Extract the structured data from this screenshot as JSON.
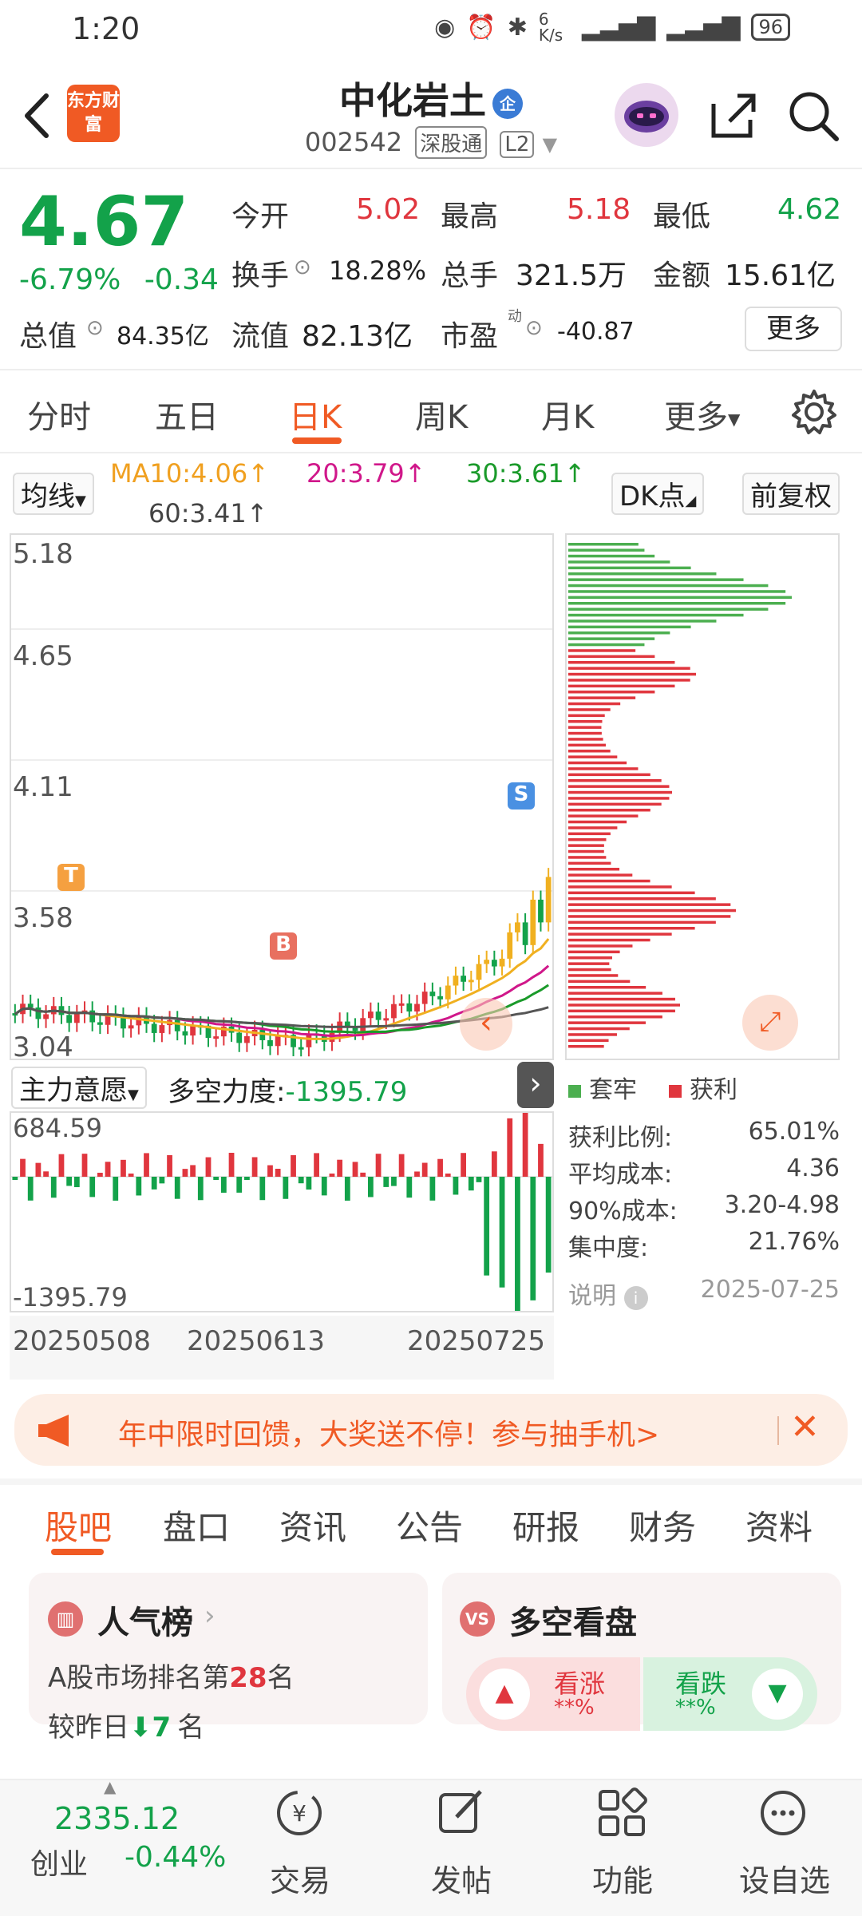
{
  "status_bar": {
    "time": "1:20",
    "speed": "6 K/s",
    "battery": "96"
  },
  "header": {
    "logo": "东方财富",
    "title": "中化岩土",
    "title_badge": "企",
    "code": "002542",
    "tags": [
      "深股通",
      "L2"
    ]
  },
  "quote": {
    "price": "4.67",
    "change_pct": "-6.79%",
    "change_amt": "-0.34",
    "open_label": "今开",
    "open": "5.02",
    "high_label": "最高",
    "high": "5.18",
    "low_label": "最低",
    "low": "4.62",
    "turnover_label": "换手",
    "turnover": "18.28%",
    "volume_label": "总手",
    "volume": "321.5万",
    "amount_label": "金额",
    "amount": "15.61亿",
    "mktcap_label": "总值",
    "mktcap": "84.35亿",
    "float_label": "流值",
    "float": "82.13亿",
    "pe_label": "市盈",
    "pe_sup": "动",
    "pe": "-40.87",
    "more_button": "更多"
  },
  "tabs": [
    "分时",
    "五日",
    "日K",
    "周K",
    "月K",
    "更多"
  ],
  "ma": {
    "selector": "均线",
    "ma10": "MA10:4.06↑",
    "ma20": "20:3.79↑",
    "ma30": "30:3.61↑",
    "ma60": "60:3.41↑",
    "dk_button": "DK点",
    "fq_button": "前复权"
  },
  "chart": {
    "y_labels": [
      "5.18",
      "4.65",
      "4.11",
      "3.58",
      "3.04"
    ],
    "marker_t": "T",
    "marker_b": "B",
    "marker_s": "S"
  },
  "indicator": {
    "selector": "主力意愿",
    "label": "多空力度:",
    "value": "-1395.79",
    "y_top": "684.59",
    "y_bottom": "-1395.79",
    "dates": [
      "20250508",
      "20250613",
      "20250725"
    ]
  },
  "chips": {
    "legend_trapped": "套牢",
    "legend_profit": "获利",
    "rows": [
      {
        "label": "获利比例:",
        "value": "65.01%"
      },
      {
        "label": "平均成本:",
        "value": "4.36"
      },
      {
        "label": "90%成本:",
        "value": "3.20-4.98"
      },
      {
        "label": "集中度:",
        "value": "21.76%"
      }
    ],
    "note_label": "说明",
    "date": "2025-07-25"
  },
  "banner": {
    "text": "年中限时回馈，大奖送不停！参与抽手机>"
  },
  "bottom_tabs": [
    "股吧",
    "盘口",
    "资讯",
    "公告",
    "研报",
    "财务",
    "资料"
  ],
  "popularity": {
    "title": "人气榜",
    "line1_prefix": "A股市场排名第",
    "rank": "28",
    "line1_suffix": "名",
    "line2_prefix": "较昨日",
    "change": "7",
    "line2_suffix": "名"
  },
  "sentiment": {
    "title": "多空看盘",
    "up_label": "看涨",
    "up_value": "**%",
    "down_label": "看跌",
    "down_value": "**%"
  },
  "footer": {
    "index_value": "2335.12",
    "index_name": "创业",
    "index_change": "-0.44%",
    "items": [
      "交易",
      "发帖",
      "功能",
      "设自选"
    ]
  }
}
